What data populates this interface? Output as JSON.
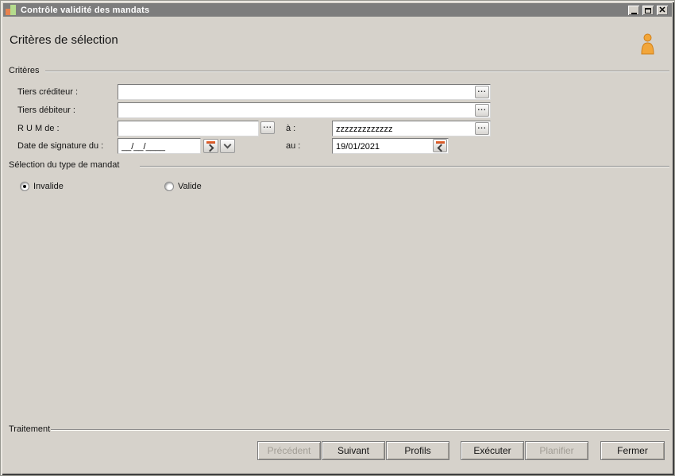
{
  "window": {
    "title": "Contrôle validité des mandats",
    "controls": {
      "minimize": "minimize-icon",
      "maximize": "maximize-icon",
      "close": "close-icon"
    }
  },
  "header": {
    "title": "Critères de sélection",
    "icon": "person-icon"
  },
  "criteria": {
    "group_label": "Critères",
    "tiers_crediteur": {
      "label": "Tiers créditeur :",
      "value": ""
    },
    "tiers_debiteur": {
      "label": "Tiers débiteur :",
      "value": ""
    },
    "rum": {
      "label": "R U M de  :",
      "from_value": "",
      "to_label": "à :",
      "to_value": "zzzzzzzzzzzzz"
    },
    "date_signature": {
      "label": "Date de signature du :",
      "from_value": "__/__/____",
      "to_label": "au :",
      "to_value": "19/01/2021"
    }
  },
  "mandate_type": {
    "group_label": "Sélection du type de mandat",
    "options": [
      {
        "label": "Invalide",
        "selected": true
      },
      {
        "label": "Valide",
        "selected": false
      }
    ]
  },
  "processing": {
    "group_label": "Traitement"
  },
  "buttons": [
    {
      "label": "Précédent",
      "enabled": false
    },
    {
      "label": "Suivant",
      "enabled": true
    },
    {
      "label": "Profils",
      "enabled": true
    },
    {
      "label": "Exécuter",
      "enabled": true
    },
    {
      "label": "Planifier",
      "enabled": false
    },
    {
      "label": "Fermer",
      "enabled": true
    }
  ],
  "colors": {
    "titlebar": "#7d7d7d",
    "background": "#d6d2cb",
    "accent_orange": "#e05a2b",
    "icon_orange": "#e8824e",
    "icon_green": "#b5dc8d",
    "person_orange": "#f2a63a"
  }
}
